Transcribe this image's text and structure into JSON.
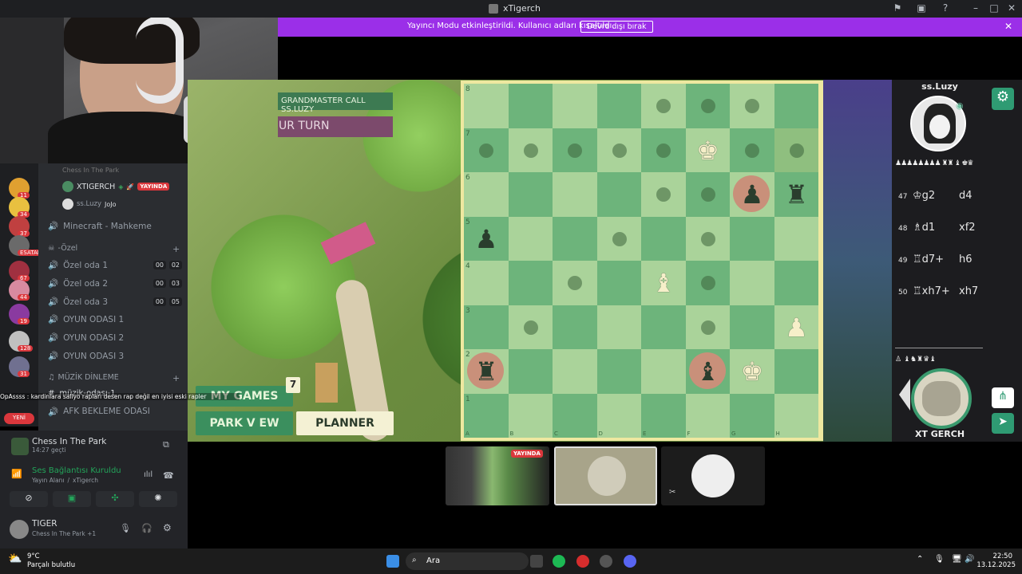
{
  "window": {
    "title": "xTigerch"
  },
  "banner": {
    "message": "Yayıncı Modu etkinleştirildi. Kullanıcı adları kısaltıldı.",
    "button": "Devre dışı bırak"
  },
  "game": {
    "tag": "GRANDMASTER CALL SS.LUZY",
    "turn": "UR TURN",
    "my_games": "MY GAMES",
    "my_games_count": "7",
    "park_view": "PARK V EW",
    "planner": "PLANNER"
  },
  "board": {
    "files": [
      "A",
      "B",
      "C",
      "D",
      "E",
      "F",
      "G",
      "H"
    ],
    "ranks": [
      "8",
      "7",
      "6",
      "5",
      "4",
      "3",
      "2",
      "1"
    ]
  },
  "opponent": {
    "name": "ss.Luzy",
    "captured": "♟♟♟♟♟♟♟♟ ♜♜ ♝ ♚♛"
  },
  "player": {
    "name": "XT GERCH",
    "captured": "♙ ♝♞♜♛♝"
  },
  "moves": [
    {
      "n": "47",
      "w": "♔g2",
      "b": "d4"
    },
    {
      "n": "48",
      "w": "♗d1",
      "b": "xf2"
    },
    {
      "n": "49",
      "w": "♖d7+",
      "b": "h6"
    },
    {
      "n": "50",
      "w": "♖xh7+",
      "b": "xh7"
    }
  ],
  "discord": {
    "server_header": "Chess In The Park",
    "live_user": "XTIGERCH",
    "live_badge": "YAYINDA",
    "sub_user": "ss.Luzy",
    "sub_user_tag": "JoJo",
    "channels": [
      {
        "name": "Minecraft - Mahkeme",
        "c1": "",
        "c2": ""
      },
      {
        "name": "Özel oda 1",
        "c1": "00",
        "c2": "02"
      },
      {
        "name": "Özel oda 2",
        "c1": "00",
        "c2": "03"
      },
      {
        "name": "Özel oda 3",
        "c1": "00",
        "c2": "05"
      },
      {
        "name": "OYUN ODASI 1",
        "c1": "",
        "c2": ""
      },
      {
        "name": "OYUN ODASI 2",
        "c1": "",
        "c2": ""
      },
      {
        "name": "OYUN ODASI 3",
        "c1": "",
        "c2": ""
      }
    ],
    "category_ozel": "-Özel",
    "category_muzik": "MÜZİK DİNLEME",
    "muzik_channel": "müzik-odası-1",
    "afk": "AFK BEKLEME ODASI",
    "new_label": "YENİ",
    "chat_overlay": "OpAssss : kardinlara saliyo rapları desen rap değil en iyisi eski rapler",
    "server_badges": [
      "11",
      "34",
      "37",
      "ESATAR",
      "67",
      "44",
      "19",
      "128",
      "31"
    ],
    "activity_title": "Chess In The Park",
    "activity_time": "14:27 geçti",
    "voice_status": "Ses Bağlantısı Kuruldu",
    "voice_channel": "Yayın Alanı",
    "voice_user": "xTigerch",
    "user_name": "TIGER",
    "user_activity": "Chess In The Park +1"
  },
  "thumb": {
    "live_badge": "YAYINDA"
  },
  "taskbar": {
    "temp": "9°C",
    "weather": "Parçalı bulutlu",
    "search": "Ara",
    "time": "22:50",
    "date": "13.12.2025"
  }
}
